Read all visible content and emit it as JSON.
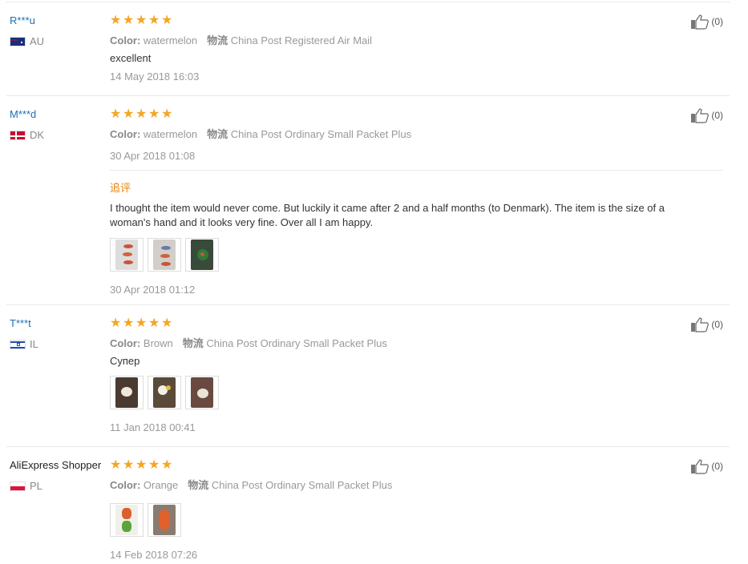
{
  "meta_labels": {
    "color": "Color:",
    "shipping": "物流"
  },
  "reviews": [
    {
      "user": "R***u",
      "country": "AU",
      "flag": "au",
      "color": "watermelon",
      "shipping": "China Post Registered Air Mail",
      "text": "excellent",
      "date": "14 May 2018 16:03",
      "likes": "(0)"
    },
    {
      "user": "M***d",
      "country": "DK",
      "flag": "dk",
      "color": "watermelon",
      "shipping": "China Post Ordinary Small Packet Plus",
      "date": "30 Apr 2018 01:08",
      "likes": "(0)",
      "additional": {
        "label": "追评",
        "text": "I thought the item would never come. But luckily it came after 2 and a half months (to Denmark). The item is the size of a woman's hand and it looks very fine. Over all I am happy.",
        "date": "30 Apr 2018 01:12"
      }
    },
    {
      "user": "T***t",
      "country": "IL",
      "flag": "il",
      "color": "Brown",
      "shipping": "China Post Ordinary Small Packet Plus",
      "text": "Супер",
      "date": "11 Jan 2018 00:41",
      "likes": "(0)"
    },
    {
      "user": "AliExpress Shopper",
      "country": "PL",
      "flag": "pl",
      "color": "Orange",
      "shipping": "China Post Ordinary Small Packet Plus",
      "date": "14 Feb 2018 07:26",
      "likes": "(0)"
    }
  ],
  "colors": {
    "star": "#f5a623",
    "username": "#1f6fb2",
    "followup_label": "#e8850c"
  }
}
